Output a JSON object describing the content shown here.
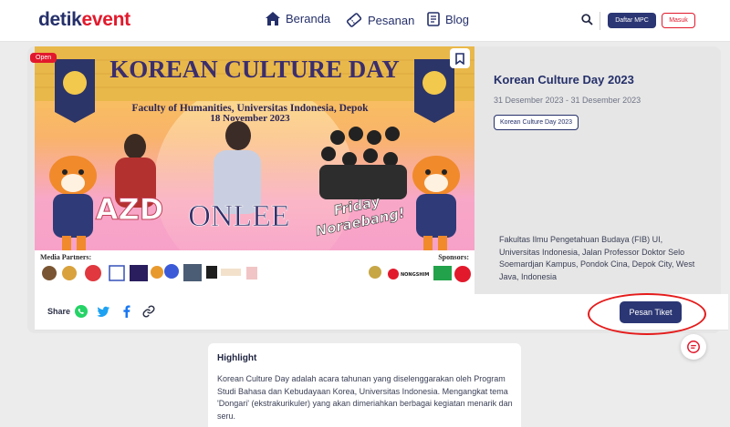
{
  "header": {
    "logo_part1": "detik",
    "logo_part2": "event",
    "nav": {
      "beranda": "Beranda",
      "pesanan": "Pesanan",
      "blog": "Blog"
    },
    "daftar_mpc": "Daftar MPC",
    "masuk": "Masuk"
  },
  "event": {
    "status_badge": "Open",
    "title": "Korean Culture Day 2023",
    "date": "31 Desember 2023 - 31 Desember 2023",
    "tag": "Korean Culture Day 2023",
    "address": "Fakultas Ilmu Pengetahuan Budaya (FIB) UI, Universitas Indonesia, Jalan Professor Doktor Selo Soemardjan Kampus, Pondok Cina, Depok City, West Java, Indonesia",
    "cta": "Pesan Tiket"
  },
  "banner": {
    "headline": "KOREAN CULTURE DAY",
    "subtitle": "Faculty of Humanities, Universitas Indonesia, Depok",
    "date": "18 November 2023",
    "performer1": "AZD",
    "performer2": "ONLEE",
    "performer3_line1": "Friday",
    "performer3_line2": "Noraebang!",
    "media_partners": "Media Partners:",
    "sponsors": "Sponsors:",
    "sponsor_nongshim": "NONGSHIM"
  },
  "share": {
    "label": "Share"
  },
  "highlight": {
    "title": "Highlight",
    "body": "Korean Culture Day adalah acara tahunan yang diselenggarakan oleh Program Studi Bahasa dan Kebudayaan Korea, Universitas Indonesia. Mengangkat tema 'Dongari' (ekstrakurikuler) yang akan dimeriahkan berbagai kegiatan menarik dan seru."
  },
  "colors": {
    "brand_navy": "#2b3674",
    "brand_red": "#e2192c",
    "annotation_red": "#e51b1b"
  }
}
